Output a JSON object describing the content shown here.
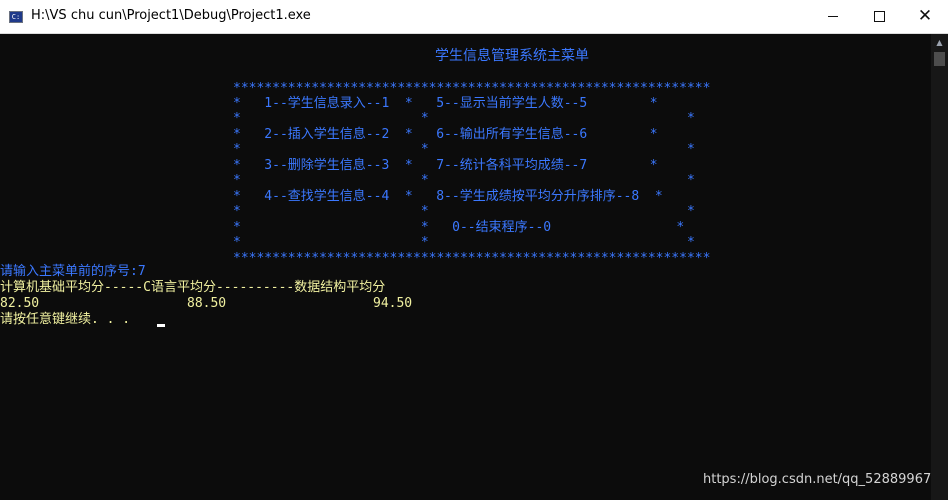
{
  "window": {
    "title": "H:\\VS chu cun\\Project1\\Debug\\Project1.exe",
    "icon": "console-app-icon",
    "controls": {
      "minimize": "minimize-icon",
      "maximize": "maximize-icon",
      "close": "✕"
    }
  },
  "menu": {
    "title": "学生信息管理系统主菜单",
    "border_line": "*************************************************************",
    "rows": [
      "*   1--学生信息录入--1  *   5--显示当前学生人数--5        *",
      "*                       *                                 *",
      "*   2--插入学生信息--2  *   6--输出所有学生信息--6        *",
      "*                       *                                 *",
      "*   3--删除学生信息--3  *   7--统计各科平均成绩--7        *",
      "*                       *                                 *",
      "*   4--查找学生信息--4  *   8--学生成绩按平均分升序排序--8  *",
      "*                       *                                 *",
      "*                       *   0--结束程序--0                *",
      "*                       *                                 *"
    ]
  },
  "console": {
    "prompt": "请输入主菜单前的序号:7",
    "header": "计算机基础平均分-----C语言平均分----------数据结构平均分",
    "averages": [
      "82.50",
      "88.50",
      "94.50"
    ],
    "continue_msg": "请按任意键继续. . ."
  },
  "watermark": "https://blog.csdn.net/qq_52889967",
  "colors": {
    "menu_text": "#3b78ff",
    "output_text": "#f1f1a0",
    "background": "#0c0c0c"
  }
}
